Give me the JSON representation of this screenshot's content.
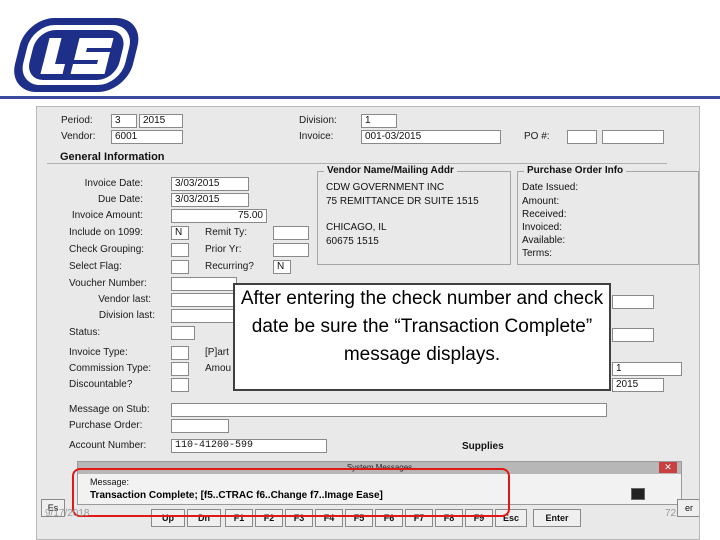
{
  "header": {
    "logo_icon": "ls-logo-icon",
    "brand_color": "#1e2f8a",
    "rule_color": "#3b4ca0"
  },
  "form": {
    "period_label": "Period:",
    "period_value": "3",
    "period_year": "2015",
    "division_label": "Division:",
    "division_value": "1",
    "vendor_label": "Vendor:",
    "vendor_value": "6001",
    "invoice_label": "Invoice:",
    "invoice_value": "001-03/2015",
    "po_label": "PO #:",
    "general_info_title": "General Information",
    "invoice_date_label": "Invoice Date:",
    "invoice_date_value": "3/03/2015",
    "due_date_label": "Due Date:",
    "due_date_value": "3/03/2015",
    "invoice_amount_label": "Invoice Amount:",
    "invoice_amount_value": "75.00",
    "include_1099_label": "Include on 1099:",
    "include_1099_value": "N",
    "remit_ty_label": "Remit Ty:",
    "check_grouping_label": "Check Grouping:",
    "prior_yr_label": "Prior Yr:",
    "select_flag_label": "Select Flag:",
    "recurring_label": "Recurring?",
    "recurring_value": "N",
    "voucher_number_label": "Voucher Number:",
    "vendor_last_label": "Vendor last:",
    "division_last_label": "Division last:",
    "status_label": "Status:",
    "invoice_type_label": "Invoice Type:",
    "invoice_type_part": "[P]art",
    "commission_type_label": "Commission Type:",
    "commission_amount_part": "Amou",
    "discountable_label": "Discountable?",
    "right_field_1": "1",
    "right_field_2": "2015",
    "message_stub_label": "Message on Stub:",
    "purchase_order_label": "Purchase Order:",
    "account_number_label": "Account Number:",
    "account_number_value": "110-41200-599",
    "account_desc": "Supplies"
  },
  "vendor_group": {
    "title": "Vendor Name/Mailing Addr",
    "line1": "CDW GOVERNMENT INC",
    "line2": "75 REMITTANCE DR  SUITE 1515",
    "line3": "CHICAGO, IL",
    "line4": "60675     1515"
  },
  "po_group": {
    "title": "Purchase Order Info",
    "date_issued": "Date Issued:",
    "amount": "Amount:",
    "received": "Received:",
    "invoiced": "Invoiced:",
    "available": "Available:",
    "terms": "Terms:"
  },
  "callout": {
    "text": "After entering the check number and check date be sure the “Transaction Complete” message displays."
  },
  "message_window": {
    "title": "System Messages",
    "close_label": "✕",
    "message_label": "Message:",
    "message_text": "Transaction Complete; [f5..CTRAC  f6..Change  f7..Image Ease]"
  },
  "function_keys": {
    "esc_left": "Es",
    "up": "Up",
    "dn": "Dn",
    "f1": "F1",
    "f2": "F2",
    "f3": "F3",
    "f4": "F4",
    "f5": "F5",
    "f6": "F6",
    "f7": "F7",
    "f8": "F8",
    "f9": "F9",
    "esc": "Esc",
    "enter": "Enter",
    "right_edge": "er"
  },
  "footer": {
    "date": "9/17/2018",
    "page": "72"
  },
  "highlight_color": "#e01818"
}
